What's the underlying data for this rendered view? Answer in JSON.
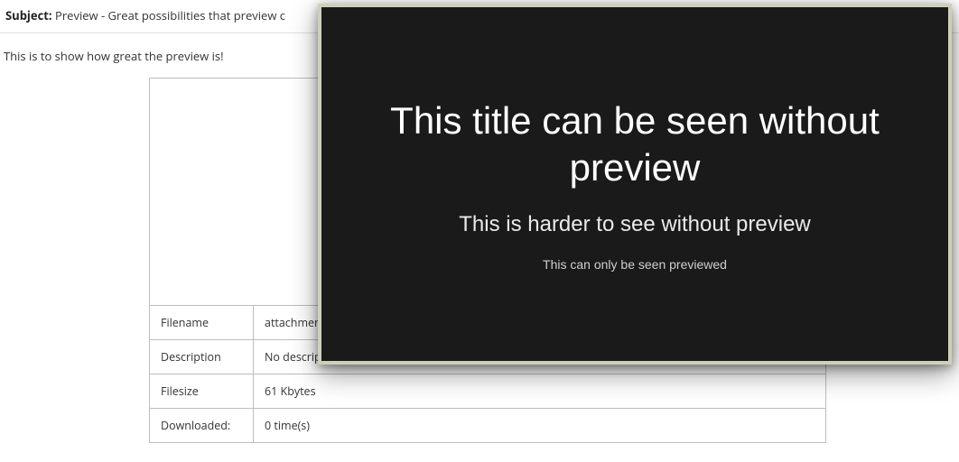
{
  "subject": {
    "label": "Subject:",
    "value": "Preview - Great possibilities that preview c"
  },
  "body": {
    "text": "This is to show how great the preview is!"
  },
  "attachment": {
    "rows": [
      {
        "key": "Filename",
        "value": "attachment"
      },
      {
        "key": "Description",
        "value": "No descript"
      },
      {
        "key": "Filesize",
        "value": "61 Kbytes"
      },
      {
        "key": "Downloaded:",
        "value": "0 time(s)"
      }
    ]
  },
  "preview": {
    "title": "This title can be seen without preview",
    "subtitle": "This is harder to see without preview",
    "small": "This can only be seen previewed"
  }
}
